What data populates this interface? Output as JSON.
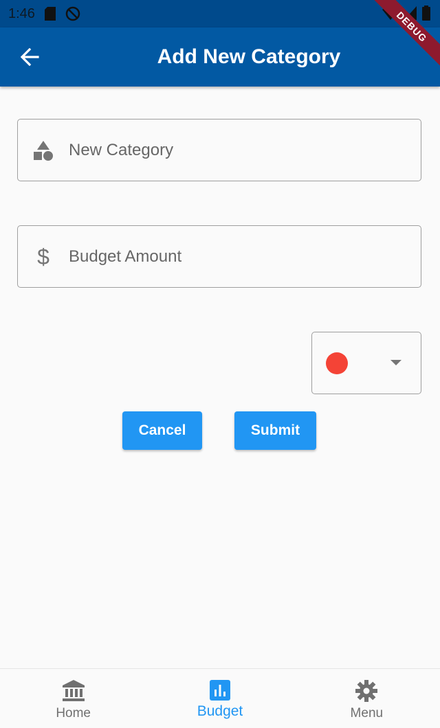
{
  "status_bar": {
    "time": "1:46",
    "icons": [
      "sd-card-icon",
      "do-not-disturb-icon",
      "wifi-icon",
      "signal-icon",
      "battery-icon"
    ]
  },
  "debug_banner": "DEBUG",
  "app_bar": {
    "title": "Add New Category",
    "back_icon": "arrow-back-icon",
    "color": "#0259a3"
  },
  "form": {
    "category_field": {
      "icon": "category-shapes-icon",
      "placeholder": "New Category",
      "value": ""
    },
    "budget_field": {
      "icon": "dollar-icon",
      "placeholder": "Budget Amount",
      "value": ""
    },
    "color_picker": {
      "selected_color": "#f44336",
      "icon": "dropdown-arrow-icon"
    },
    "cancel_label": "Cancel",
    "submit_label": "Submit",
    "button_color": "#2196f3"
  },
  "bottom_nav": {
    "items": [
      {
        "label": "Home",
        "icon": "bank-icon",
        "active": false
      },
      {
        "label": "Budget",
        "icon": "bar-chart-icon",
        "active": true
      },
      {
        "label": "Menu",
        "icon": "gear-icon",
        "active": false
      }
    ],
    "active_color": "#2196f3"
  }
}
